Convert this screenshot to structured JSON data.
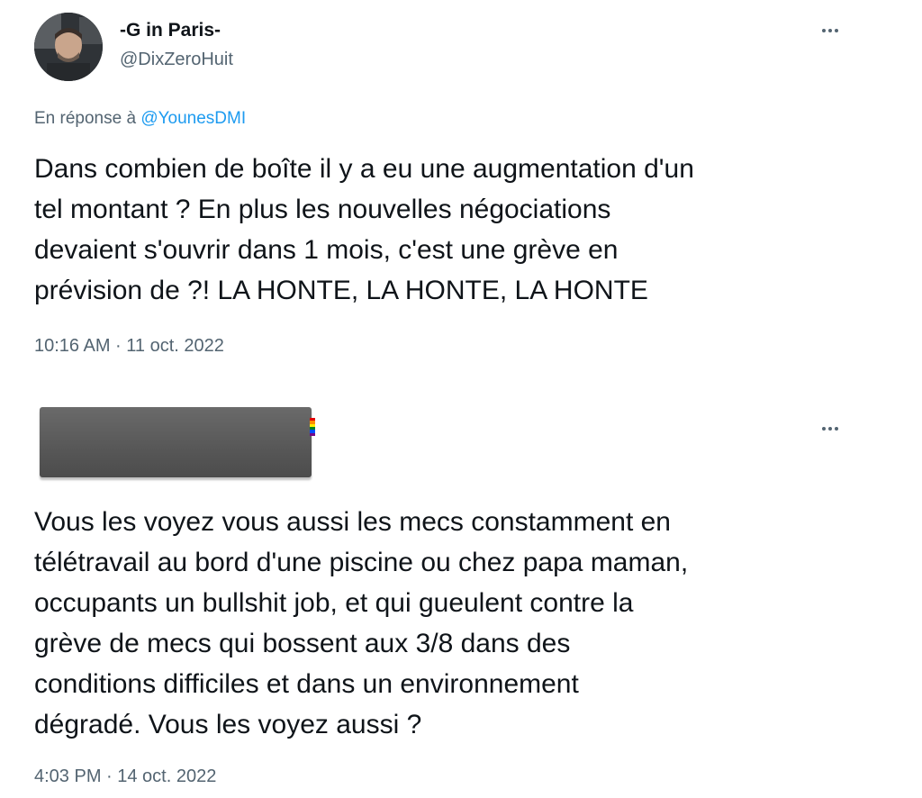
{
  "tweet1": {
    "display_name": "-G in Paris-",
    "handle": "@DixZeroHuit",
    "reply_prefix": "En réponse à ",
    "reply_mention": "@YounesDMI",
    "text": "Dans combien de boîte il y a eu une augmentation d'un\ntel montant ? En plus les nouvelles négociations\ndevaient s'ouvrir dans 1 mois, c'est une grève en\nprévision de ?! LA HONTE, LA HONTE, LA HONTE",
    "timestamp": "10:16 AM · 11 oct. 2022"
  },
  "tweet2": {
    "text": "Vous les voyez vous aussi les mecs constamment en\ntélétravail au bord d'une piscine ou chez papa maman,\noccupants un bullshit job, et qui gueulent contre la\ngrève de mecs qui bossent aux 3/8 dans des\nconditions difficiles et dans un environnement\ndégradé. Vous les voyez aussi ?",
    "timestamp": "4:03 PM · 14 oct. 2022"
  },
  "icons": {
    "more": "more-horizontal-icon",
    "flag": "rainbow-flag-icon"
  },
  "colors": {
    "text": "#0f1419",
    "secondary": "#536471",
    "link": "#1d9bf0",
    "redaction": "#5a5a5a"
  }
}
